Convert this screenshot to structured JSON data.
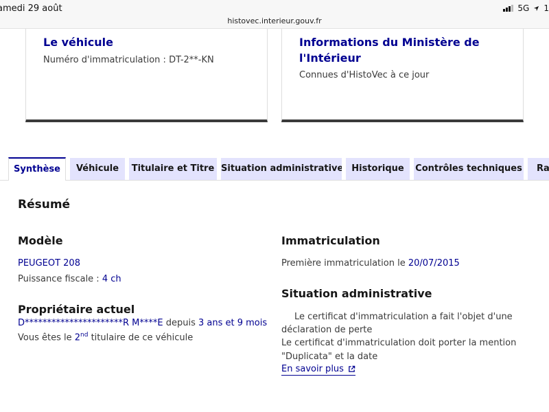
{
  "status_bar": {
    "time": "amedi 29 août",
    "url": "histovec.interieur.gouv.fr",
    "network": "5G",
    "battery": "1"
  },
  "cards": {
    "vehicle": {
      "title": "Le véhicule",
      "plate_label": "Numéro d'immatriculation : ",
      "plate_value": "DT-2**-KN"
    },
    "ministry": {
      "title": "Informations du Ministère de l'Intérieur",
      "subtitle": "Connues d'HistoVec à ce jour"
    }
  },
  "tabs": [
    {
      "label": "Synthèse",
      "active": true
    },
    {
      "label": "Véhicule"
    },
    {
      "label": "Titulaire et Titre"
    },
    {
      "label": "Situation administrative"
    },
    {
      "label": "Historique"
    },
    {
      "label": "Contrôles techniques"
    },
    {
      "label": "Rap"
    }
  ],
  "summary": {
    "title": "Résumé",
    "model": {
      "heading": "Modèle",
      "name": "PEUGEOT 208",
      "power_label": "Puissance fiscale : ",
      "power_value": "4 ch"
    },
    "owner": {
      "heading": "Propriétaire actuel",
      "name": "D**********************R M****E",
      "since_label": " depuis ",
      "since_value": "3 ans et 9 mois",
      "rank_prefix": "Vous êtes le ",
      "rank_number": "2",
      "rank_sup": "nd",
      "rank_suffix": " titulaire de ce véhicule"
    },
    "registration": {
      "heading": "Immatriculation",
      "first_label": "Première immatriculation le ",
      "first_value": "20/07/2015"
    },
    "admin": {
      "heading": "Situation administrative",
      "line1": "Le certificat d'immatriculation a fait l'objet d'une",
      "line2": "déclaration de perte",
      "line3": "Le certificat d'immatriculation doit porter la mention",
      "line4": "\"Duplicata\" et la date",
      "link": "En savoir plus"
    }
  },
  "colors": {
    "brand_blue": "#000091",
    "tab_background": "#e3e3fd",
    "text": "#3a3a3a"
  }
}
